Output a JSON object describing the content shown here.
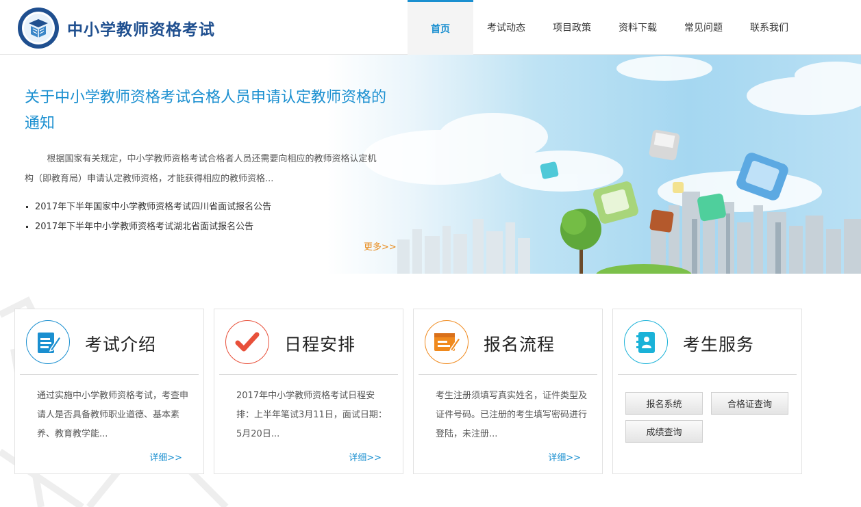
{
  "header": {
    "site_title": "中小学教师资格考试",
    "nav": [
      "首页",
      "考试动态",
      "项目政策",
      "资料下载",
      "常见问题",
      "联系我们"
    ]
  },
  "banner": {
    "title": "关于中小学教师资格考试合格人员申请认定教师资格的通知",
    "description": "根据国家有关规定，中小学教师资格考试合格者人员还需要向相应的教师资格认定机构（即教育局）申请认定教师资格，才能获得相应的教师资格...",
    "notices": [
      "2017年下半年国家中小学教师资格考试四川省面试报名公告",
      "2017年下半年中小学教师资格考试湖北省面试报名公告"
    ],
    "more": "更多>>"
  },
  "cards": [
    {
      "title": "考试介绍",
      "text": "通过实施中小学教师资格考试，考查申请人是否具备教师职业道德、基本素养、教育教学能...",
      "more": "详细>>",
      "icon": "document-edit-icon",
      "color": "#1a8fd0"
    },
    {
      "title": "日程安排",
      "text": "2017年中小学教师资格考试日程安排：上半年笔试3月11日，面试日期：5月20日...",
      "more": "详细>>",
      "icon": "checkmark-icon",
      "color": "#e8503a"
    },
    {
      "title": "报名流程",
      "text": "考生注册须填写真实姓名，证件类型及证件号码。已注册的考生填写密码进行登陆，未注册...",
      "more": "详细>>",
      "icon": "form-pen-icon",
      "color": "#f08a1e"
    },
    {
      "title": "考生服务",
      "icon": "contact-book-icon",
      "color": "#1ab2d8",
      "buttons": [
        "报名系统",
        "合格证查询",
        "成绩查询"
      ]
    }
  ]
}
